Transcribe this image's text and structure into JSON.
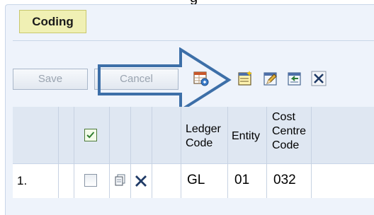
{
  "page": {
    "top_caption": "g",
    "section_tab": "Coding"
  },
  "toolbar": {
    "save_label": "Save",
    "cancel_label": "Cancel",
    "icons": [
      "grid-settings-icon",
      "new-row-icon",
      "edit-icon",
      "import-icon",
      "delete-icon"
    ]
  },
  "grid": {
    "headers": {
      "ledger_code": [
        "Ledger",
        "Code"
      ],
      "entity": "Entity",
      "cost_centre_code": [
        "Cost",
        "Centre",
        "Code"
      ]
    },
    "rows": [
      {
        "row_number": "1.",
        "ledger_code": "GL",
        "entity": "01",
        "cost_centre_code": "032"
      }
    ]
  },
  "colors": {
    "panel_bg": "#eef3fb",
    "tab_bg": "#f0f0b4",
    "header_bg": "#dfe7f2",
    "arrow_stroke": "#3d6fa8"
  }
}
